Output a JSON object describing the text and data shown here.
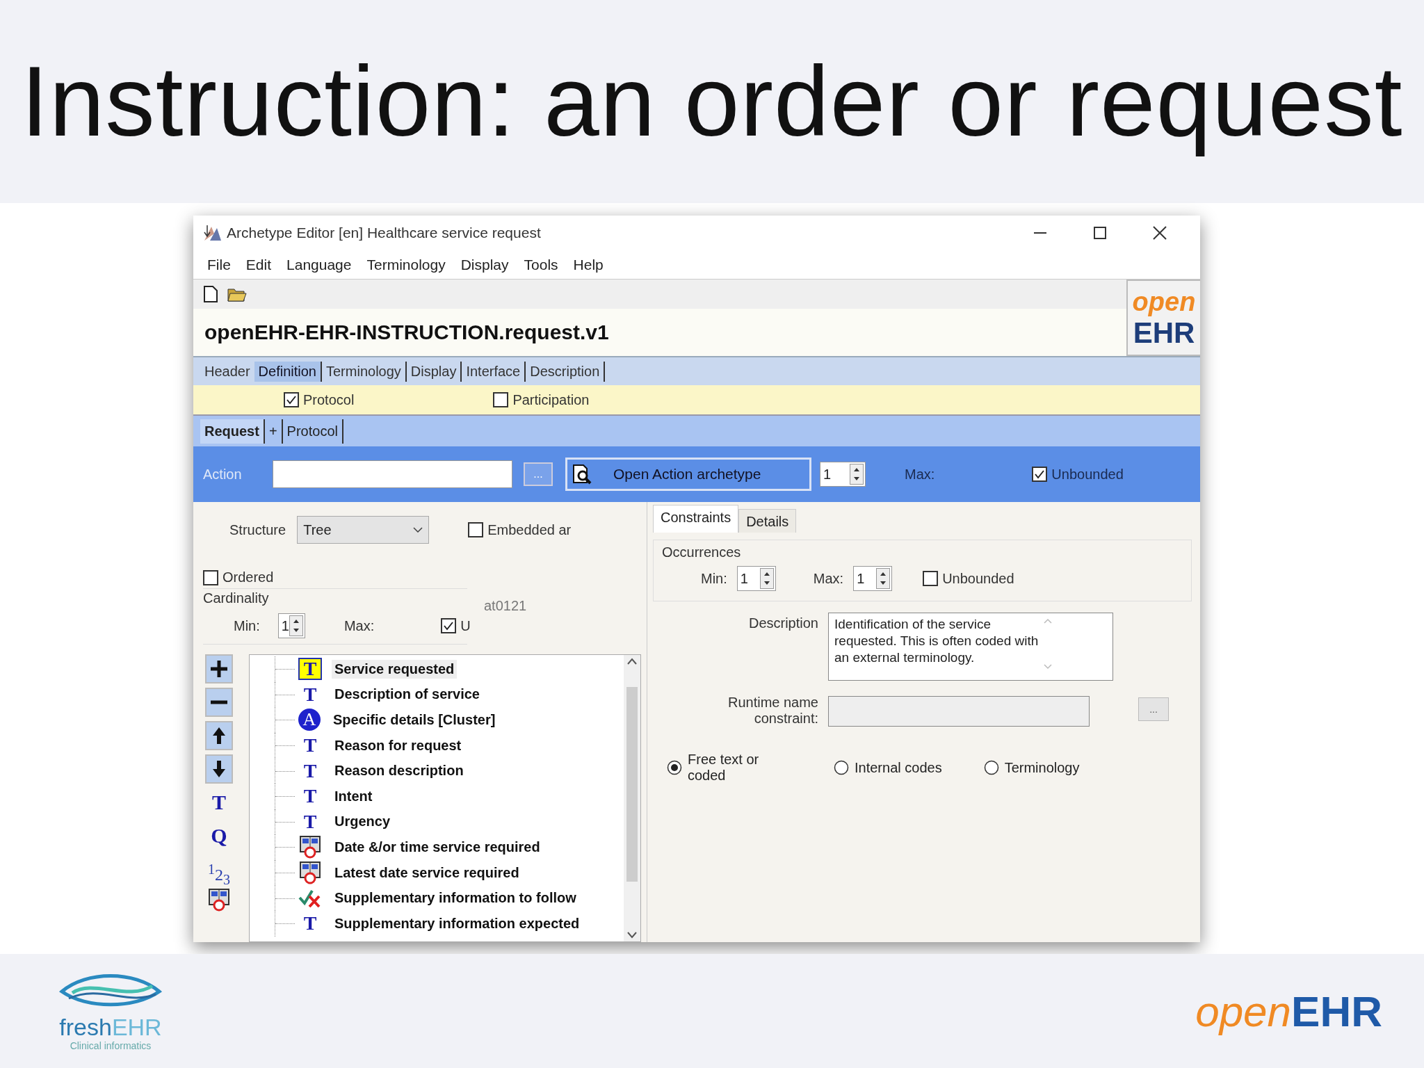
{
  "slide_title": "Instruction: an order or request",
  "window": {
    "title": "Archetype Editor [en] Healthcare service request",
    "menu": [
      "File",
      "Edit",
      "Language",
      "Terminology",
      "Display",
      "Tools",
      "Help"
    ],
    "archetype_id": "openEHR-EHR-INSTRUCTION.request.v1",
    "logo": {
      "a": "open",
      "b": "EHR"
    }
  },
  "tabs": [
    {
      "label": "Header",
      "selected": false
    },
    {
      "label": "Definition",
      "selected": true
    },
    {
      "label": "Terminology",
      "selected": false
    },
    {
      "label": "Display",
      "selected": false
    },
    {
      "label": "Interface",
      "selected": false
    },
    {
      "label": "Description",
      "selected": false
    }
  ],
  "options": [
    {
      "label": "Protocol",
      "checked": true
    },
    {
      "label": "Participation",
      "checked": false
    }
  ],
  "subtabs": [
    {
      "label": "Request",
      "selected": true
    },
    {
      "label": "+",
      "selected": false
    },
    {
      "label": "Protocol",
      "selected": false
    }
  ],
  "action": {
    "label": "Action",
    "browse": "...",
    "open_button": "Open Action archetype",
    "min": "1",
    "max_label": "Max:",
    "unbounded": {
      "label": "Unbounded",
      "checked": true
    }
  },
  "structure": {
    "label": "Structure",
    "value": "Tree",
    "embedded": {
      "label": "Embedded ar",
      "checked": false
    },
    "ordered": {
      "label": "Ordered",
      "checked": false
    }
  },
  "cardinality": {
    "title": "Cardinality",
    "min_label": "Min:",
    "min": "1",
    "max_label": "Max:",
    "unbounded": {
      "label": "U",
      "checked": true
    }
  },
  "node_code": "at0121",
  "tools": [
    {
      "kind": "add"
    },
    {
      "kind": "remove"
    },
    {
      "kind": "up"
    },
    {
      "kind": "down"
    },
    {
      "kind": "glyph",
      "glyph": "T"
    },
    {
      "kind": "glyph",
      "glyph": "Q"
    },
    {
      "kind": "count",
      "glyph": "$^{1}$2$_{3}$"
    },
    {
      "kind": "datetime"
    }
  ],
  "tree": [
    {
      "kind": "text",
      "icon": "T",
      "label": "Service requested",
      "selected": true
    },
    {
      "kind": "text",
      "icon": "T",
      "label": "Description of service",
      "selected": false
    },
    {
      "kind": "cluster",
      "icon": "A",
      "label": "Specific details [Cluster]",
      "selected": false
    },
    {
      "kind": "text",
      "icon": "T",
      "label": "Reason for request",
      "selected": false
    },
    {
      "kind": "text",
      "icon": "T",
      "label": "Reason description",
      "selected": false
    },
    {
      "kind": "text",
      "icon": "T",
      "label": "Intent",
      "selected": false
    },
    {
      "kind": "text",
      "icon": "T",
      "label": "Urgency",
      "selected": false
    },
    {
      "kind": "datetime",
      "label": "Date &/or time service required",
      "selected": false
    },
    {
      "kind": "datetime",
      "label": "Latest date service required",
      "selected": false
    },
    {
      "kind": "boolean",
      "label": "Supplementary information to follow",
      "selected": false
    },
    {
      "kind": "text",
      "icon": "T",
      "label": "Supplementary information expected",
      "selected": false
    }
  ],
  "detail_tabs": [
    {
      "label": "Constraints",
      "selected": true
    },
    {
      "label": "Details",
      "selected": false
    }
  ],
  "occurrences": {
    "title": "Occurrences",
    "min_label": "Min:",
    "min": "1",
    "max_label": "Max:",
    "max": "1",
    "unbounded": {
      "label": "Unbounded",
      "checked": false
    }
  },
  "description": {
    "label": "Description",
    "value": "Identification of the service requested. This is often coded with an external terminology."
  },
  "runtime_name": {
    "label": "Runtime name constraint:",
    "button": "..."
  },
  "coding": [
    {
      "label": "Free text or coded",
      "selected": true
    },
    {
      "label": "Internal codes",
      "selected": false
    },
    {
      "label": "Terminology",
      "selected": false
    }
  ],
  "footer": {
    "left_logo": {
      "a": "fresh",
      "b": "EHR",
      "tagline": "Clinical informatics"
    },
    "right_logo": {
      "a": "open",
      "b": "EHR"
    }
  }
}
